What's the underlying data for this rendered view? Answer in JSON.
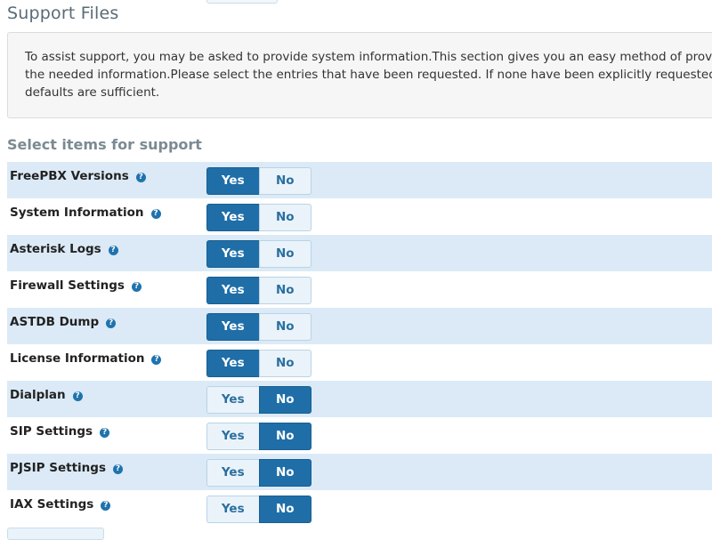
{
  "page": {
    "title": "Support Files",
    "info_text": "To assist support, you may be asked to provide system information.This section gives you an easy method of provid\nthe needed information.Please select the entries that have been requested. If none have been explicitly requested,\ndefaults are sufficient.",
    "subheading": "Select items for support"
  },
  "toggle_labels": {
    "yes": "Yes",
    "no": "No"
  },
  "items": [
    {
      "label": "FreePBX Versions",
      "value": "Yes"
    },
    {
      "label": "System Information",
      "value": "Yes"
    },
    {
      "label": "Asterisk Logs",
      "value": "Yes"
    },
    {
      "label": "Firewall Settings",
      "value": "Yes"
    },
    {
      "label": "ASTDB Dump",
      "value": "Yes"
    },
    {
      "label": "License Information",
      "value": "Yes"
    },
    {
      "label": "Dialplan",
      "value": "No"
    },
    {
      "label": "SIP Settings",
      "value": "No"
    },
    {
      "label": "PJSIP Settings",
      "value": "No"
    },
    {
      "label": "IAX Settings",
      "value": "No"
    }
  ],
  "help_icon": {
    "icon": "help-icon",
    "glyph": "?"
  },
  "colors": {
    "accent": "#1f6ea8",
    "row_stripe": "#dbeaf6",
    "inactive_option": "#eaf3fa"
  }
}
